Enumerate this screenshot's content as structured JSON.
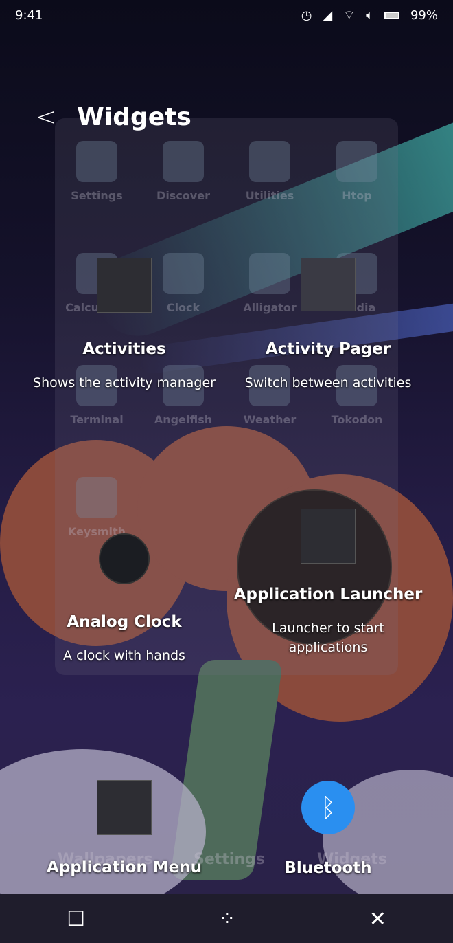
{
  "status": {
    "time": "9:41",
    "battery": "99%",
    "icons": [
      "alarm-icon",
      "signal-icon",
      "wifi-icon",
      "volume-icon",
      "battery-icon"
    ]
  },
  "header": {
    "title": "Widgets",
    "back_icon": "chevron-left-icon"
  },
  "background_apps": [
    "Settings",
    "Discover",
    "Utilities",
    "Htop",
    "Calculator",
    "Clock",
    "Alligator",
    "Media",
    "Terminal",
    "Angelfish",
    "Weather",
    "Tokodon",
    "Keysmith"
  ],
  "background_dock": [
    "Wallpapers",
    "Settings",
    "Widgets"
  ],
  "widgets": [
    {
      "name": "Activities",
      "desc": "Shows the activity manager"
    },
    {
      "name": "Activity Pager",
      "desc": "Switch between activities"
    },
    {
      "name": "Analog Clock",
      "desc": "A clock with hands"
    },
    {
      "name": "Application Launcher",
      "desc": "Launcher to start applications"
    },
    {
      "name": "Application Menu",
      "desc": ""
    },
    {
      "name": "Bluetooth",
      "desc": ""
    }
  ],
  "colors": {
    "bluetooth": "#2a8ff0",
    "accent_clock": "#3aa0c8"
  },
  "nav": [
    "overview-icon",
    "home-icon",
    "close-icon"
  ]
}
